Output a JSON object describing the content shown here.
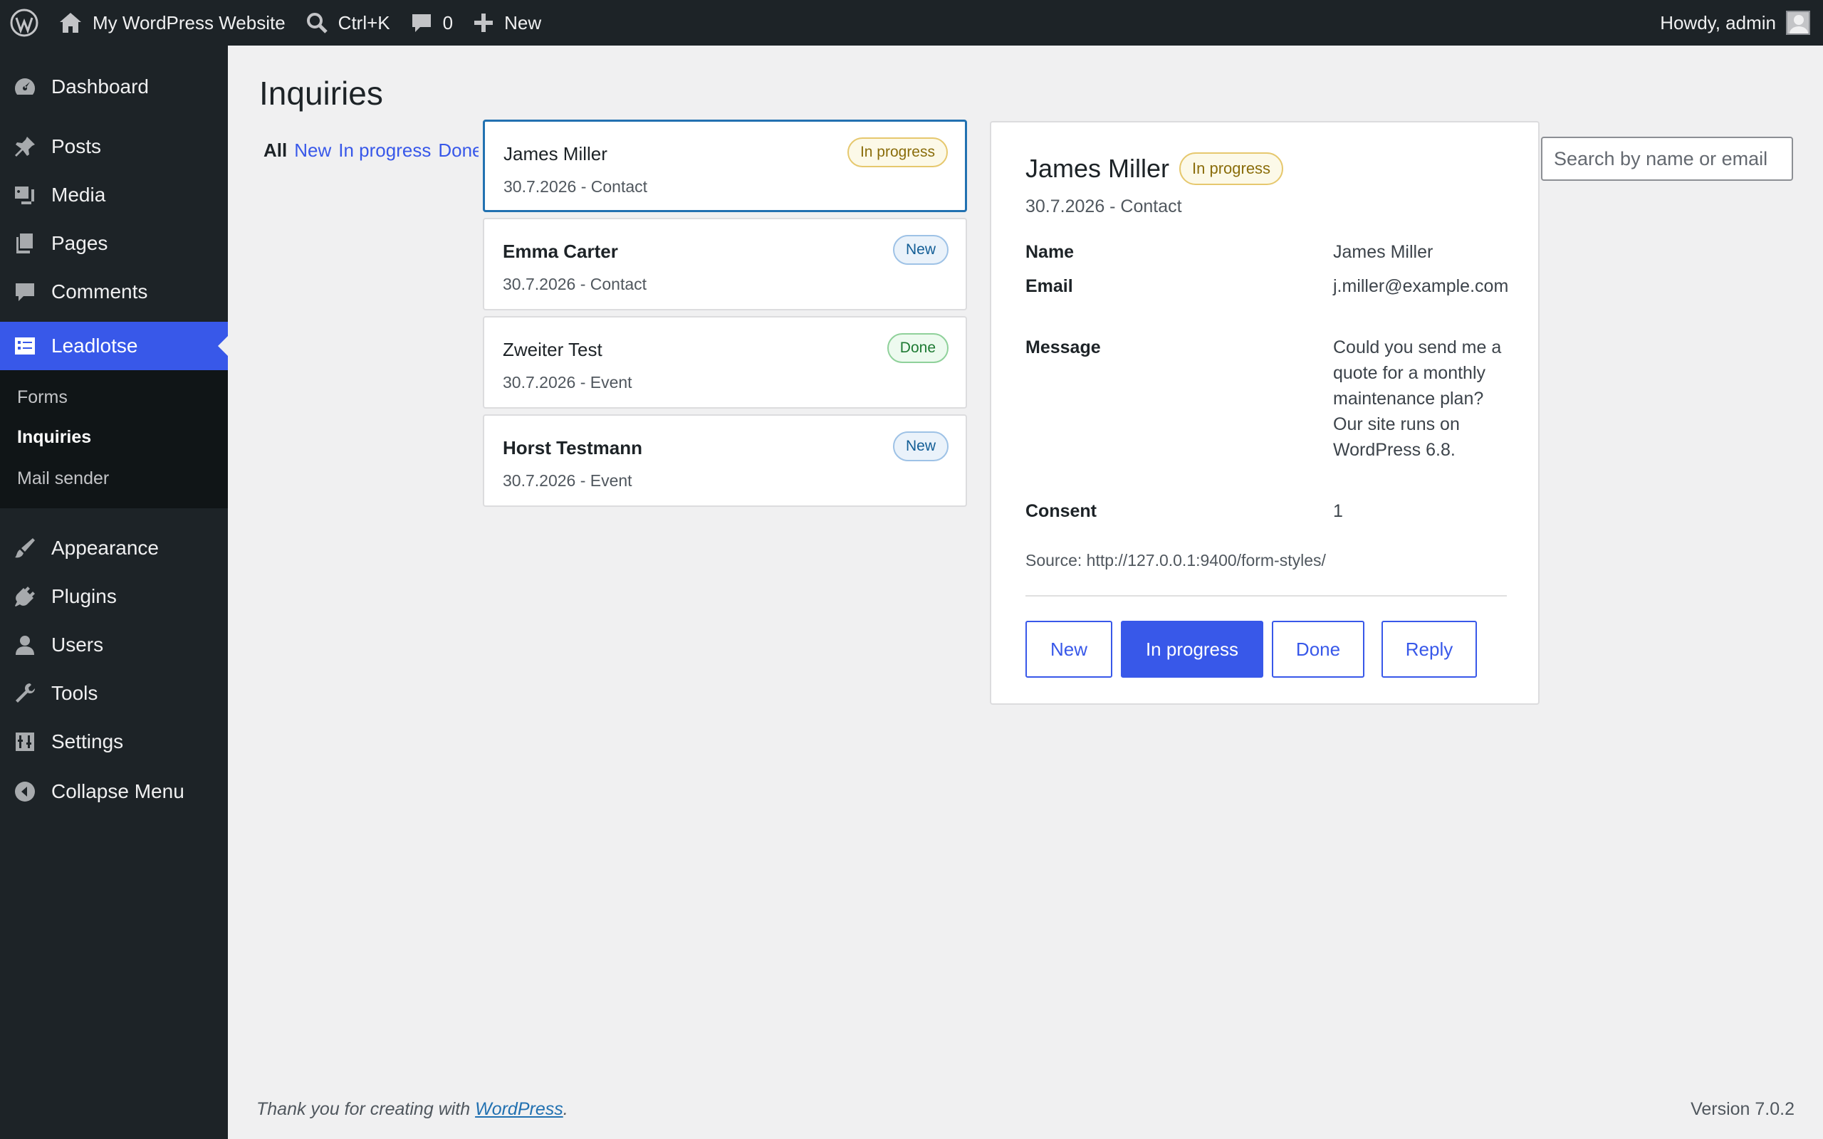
{
  "adminbar": {
    "site_name": "My WordPress Website",
    "search_shortcut": "Ctrl+K",
    "comments_count": "0",
    "new_label": "New",
    "howdy": "Howdy, admin"
  },
  "sidebar": {
    "items": [
      {
        "label": "Dashboard",
        "icon": "dashboard-icon"
      },
      {
        "label": "Posts",
        "icon": "pin-icon"
      },
      {
        "label": "Media",
        "icon": "media-icon"
      },
      {
        "label": "Pages",
        "icon": "pages-icon"
      },
      {
        "label": "Comments",
        "icon": "comment-icon"
      },
      {
        "label": "Leadlotse",
        "icon": "form-icon"
      },
      {
        "label": "Appearance",
        "icon": "brush-icon"
      },
      {
        "label": "Plugins",
        "icon": "plugin-icon"
      },
      {
        "label": "Users",
        "icon": "user-icon"
      },
      {
        "label": "Tools",
        "icon": "wrench-icon"
      },
      {
        "label": "Settings",
        "icon": "settings-icon"
      },
      {
        "label": "Collapse Menu",
        "icon": "collapse-icon"
      }
    ],
    "submenu": [
      "Forms",
      "Inquiries",
      "Mail sender"
    ]
  },
  "main": {
    "title": "Inquiries",
    "filters": [
      "All",
      "New",
      "In progress",
      "Done"
    ],
    "search_placeholder": "Search by name or email"
  },
  "inquiries": [
    {
      "name": "James Miller",
      "meta": "30.7.2026 - Contact",
      "status": "In progress"
    },
    {
      "name": "Emma Carter",
      "meta": "30.7.2026 - Contact",
      "status": "New"
    },
    {
      "name": "Zweiter Test",
      "meta": "30.7.2026 - Event",
      "status": "Done"
    },
    {
      "name": "Horst Testmann",
      "meta": "30.7.2026 - Event",
      "status": "New"
    }
  ],
  "detail": {
    "name": "James Miller",
    "status": "In progress",
    "meta": "30.7.2026 - Contact",
    "fields": [
      {
        "label": "Name",
        "value": "James Miller"
      },
      {
        "label": "Email",
        "value": "j.miller@example.com"
      },
      {
        "label": "Message",
        "value": "Could you send me a quote for a monthly maintenance plan? Our site runs on WordPress 6.8."
      },
      {
        "label": "Consent",
        "value": "1"
      }
    ],
    "source": "Source: http://127.0.0.1:9400/form-styles/",
    "buttons": [
      "New",
      "In progress",
      "Done",
      "Reply"
    ]
  },
  "footer": {
    "thanks_prefix": "Thank you for creating with ",
    "thanks_link": "WordPress",
    "thanks_suffix": ".",
    "version": "Version 7.0.2"
  },
  "colors": {
    "accent": "#3858e9",
    "adminbar": "#1d2327",
    "selected_border": "#2271b1"
  }
}
